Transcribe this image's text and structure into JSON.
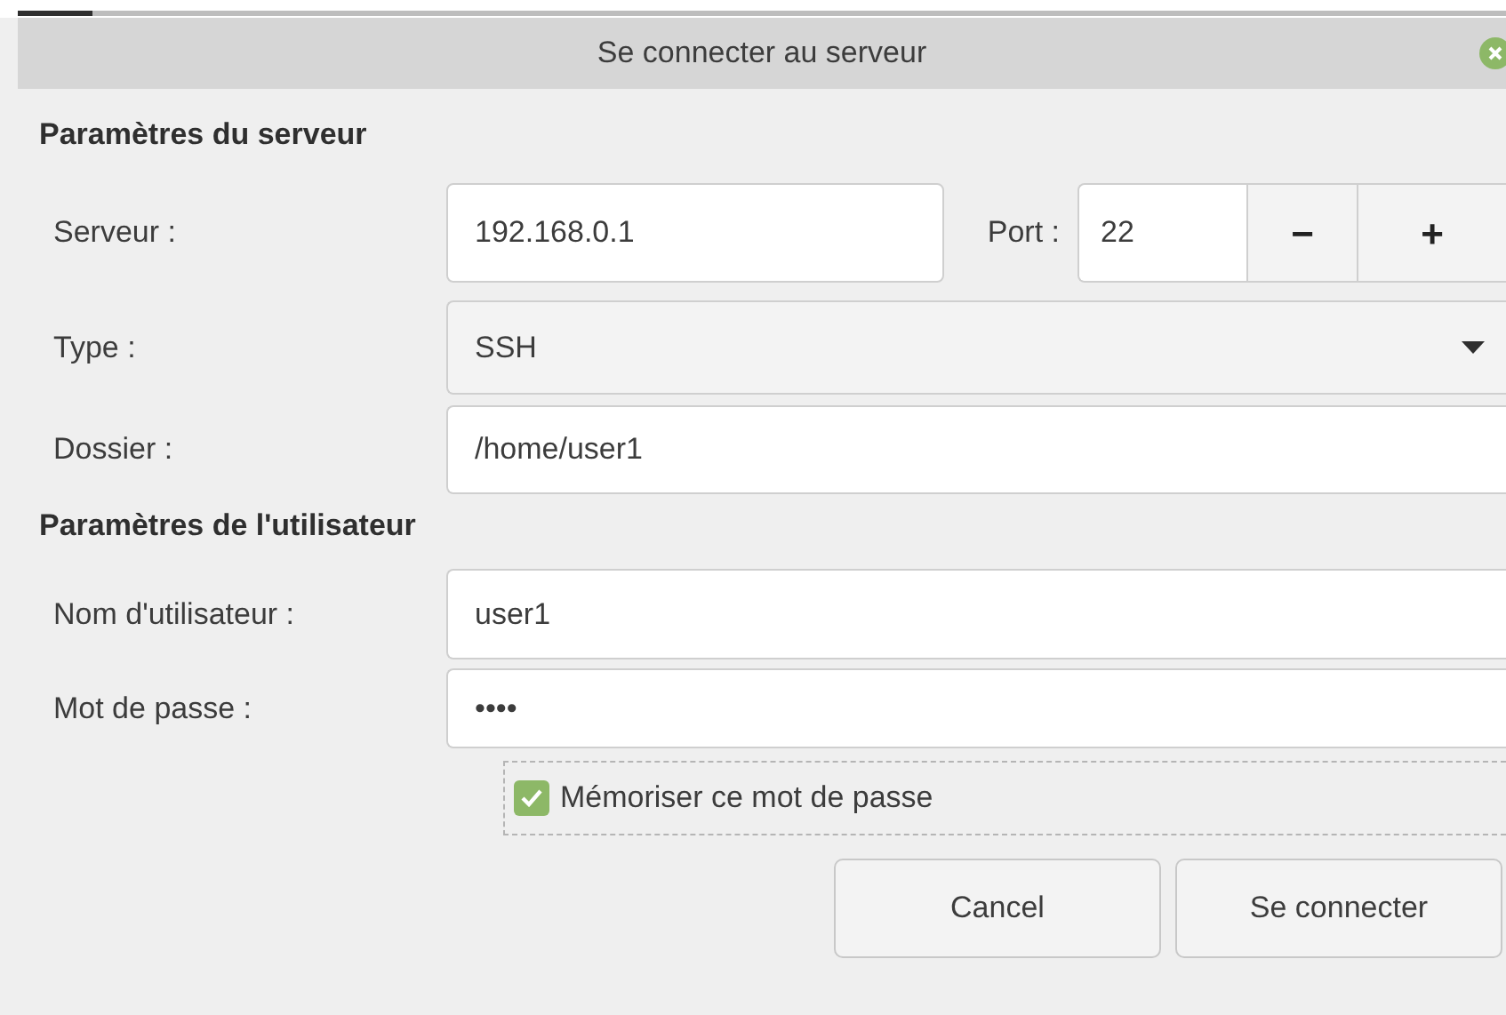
{
  "window": {
    "title": "Se connecter au serveur"
  },
  "server_section": {
    "heading": "Paramètres du serveur",
    "server": {
      "label": "Serveur :",
      "value": "192.168.0.1"
    },
    "port": {
      "label": "Port :",
      "value": "22",
      "decrement": "−",
      "increment": "+"
    },
    "type": {
      "label": "Type :",
      "value": "SSH"
    },
    "folder": {
      "label": "Dossier :",
      "value": "/home/user1"
    }
  },
  "user_section": {
    "heading": "Paramètres de l'utilisateur",
    "username": {
      "label": "Nom d'utilisateur :",
      "value": "user1"
    },
    "password": {
      "label": "Mot de passe :",
      "value": "••••"
    },
    "remember": {
      "label": "Mémoriser ce mot de passe",
      "checked": true
    }
  },
  "buttons": [
    {
      "label": "Cancel"
    },
    {
      "label": "Se connecter"
    }
  ]
}
